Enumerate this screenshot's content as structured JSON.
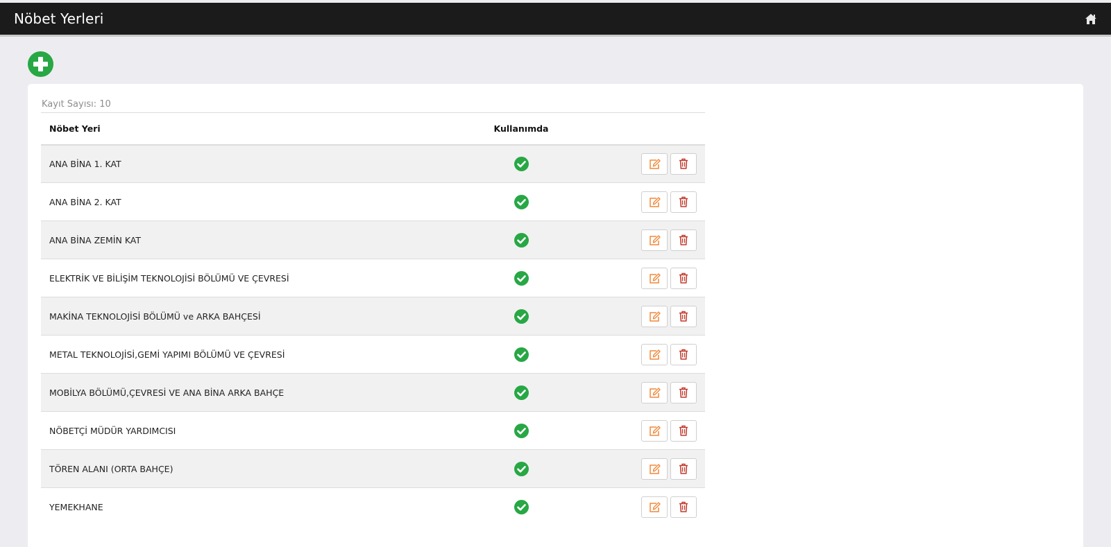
{
  "header": {
    "title": "Nöbet Yerleri",
    "home_icon": "home-icon"
  },
  "toolbar": {
    "add_icon": "plus-circle-icon"
  },
  "card": {
    "record_count": "Kayıt Sayısı: 10"
  },
  "table": {
    "columns": [
      "Nöbet Yeri",
      "Kullanımda",
      ""
    ],
    "rows": [
      {
        "name": "ANA BİNA 1. KAT",
        "in_use": true
      },
      {
        "name": "ANA BİNA 2. KAT",
        "in_use": true
      },
      {
        "name": "ANA BİNA ZEMİN KAT",
        "in_use": true
      },
      {
        "name": "ELEKTRİK VE BİLİŞİM TEKNOLOJİSİ BÖLÜMÜ VE ÇEVRESİ",
        "in_use": true
      },
      {
        "name": "MAKİNA TEKNOLOJİSİ BÖLÜMÜ ve ARKA BAHÇESİ",
        "in_use": true
      },
      {
        "name": "METAL TEKNOLOJİSİ,GEMİ YAPIMI BÖLÜMÜ VE ÇEVRESİ",
        "in_use": true
      },
      {
        "name": "MOBİLYA BÖLÜMÜ,ÇEVRESİ VE ANA BİNA ARKA BAHÇE",
        "in_use": true
      },
      {
        "name": "NÖBETÇİ MÜDÜR YARDIMCISI",
        "in_use": true
      },
      {
        "name": "TÖREN ALANI (ORTA BAHÇE)",
        "in_use": true
      },
      {
        "name": "YEMEKHANE",
        "in_use": true
      }
    ],
    "row_icons": {
      "status": "check-circle-icon",
      "edit": "edit-icon",
      "delete": "trash-icon"
    }
  },
  "colors": {
    "header_bg": "#1b1b1b",
    "page_bg": "#ededf1",
    "success": "#28a745",
    "edit": "#f0883a",
    "delete": "#c0392b"
  }
}
